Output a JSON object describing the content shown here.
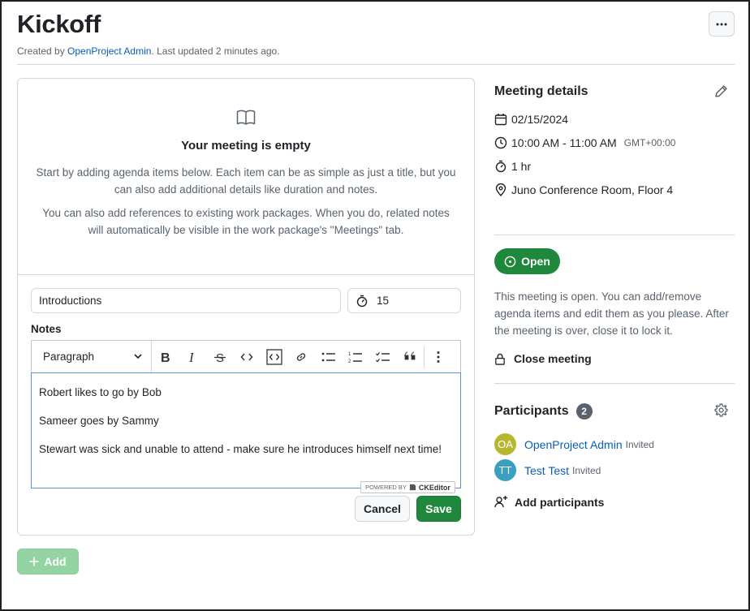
{
  "header": {
    "title": "Kickoff",
    "created_prefix": "Created by ",
    "author": "OpenProject Admin",
    "updated_suffix": ". Last updated 2 minutes ago.",
    "more_label": "…"
  },
  "agenda": {
    "empty_title": "Your meeting is empty",
    "empty_text_1": "Start by adding agenda items below. Each item can be as simple as just a title, but you can also add additional details like duration and notes.",
    "empty_text_2": "You can also add references to existing work packages. When you do, related notes will automatically be visible in the work package's \"Meetings\" tab.",
    "form": {
      "title_value": "Introductions",
      "duration_value": "15",
      "notes_label": "Notes",
      "format_select": "Paragraph",
      "notes_lines": [
        "Robert likes to go by Bob",
        "Sameer goes by Sammy",
        "Stewart was sick and unable to attend - make sure he introduces himself next time!"
      ],
      "powered_by": "POWERED BY",
      "ckeditor": "CKEditor",
      "cancel_label": "Cancel",
      "save_label": "Save"
    },
    "add_label": "Add"
  },
  "sidebar": {
    "details_title": "Meeting details",
    "date": "02/15/2024",
    "time": "10:00 AM - 11:00 AM",
    "timezone": "GMT+00:00",
    "duration": "1 hr",
    "location": "Juno Conference Room, Floor 4",
    "status_label": "Open",
    "status_text": "This meeting is open. You can add/remove agenda items and edit them as you please. After the meeting is over, close it to lock it.",
    "close_label": "Close meeting",
    "participants_title": "Participants",
    "participants_count": "2",
    "participants": [
      {
        "initials": "OA",
        "name": "OpenProject Admin",
        "status": "Invited",
        "color": "#b5b82e"
      },
      {
        "initials": "TT",
        "name": "Test Test",
        "status": "Invited",
        "color": "#3b9fc1"
      }
    ],
    "add_participants_label": "Add participants"
  },
  "colors": {
    "primary": "#1f883d",
    "link": "#0a5cb8",
    "muted": "#59636e"
  }
}
